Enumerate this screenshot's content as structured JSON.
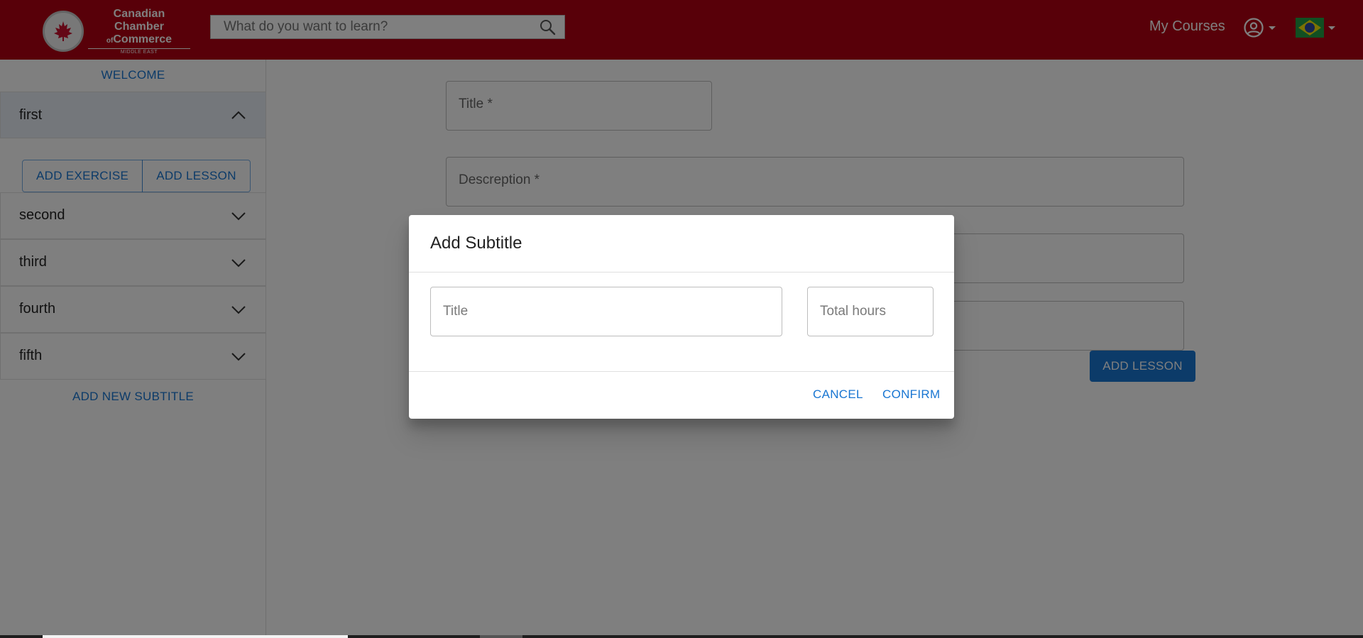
{
  "header": {
    "logo": {
      "seal_text": "CanCham",
      "line1": "Canadian Chamber",
      "line2_prefix": "of",
      "line2": "Commerce",
      "line3": "MIDDLE EAST"
    },
    "search": {
      "placeholder": "What do you want to learn?",
      "icon": "search-icon"
    },
    "my_courses": "My Courses",
    "account_icon": "account-circle-icon",
    "language_flag": "brazil-flag-icon"
  },
  "sidebar": {
    "welcome": "WELCOME",
    "items": [
      {
        "label": "first",
        "expanded": true
      },
      {
        "label": "second",
        "expanded": false
      },
      {
        "label": "third",
        "expanded": false
      },
      {
        "label": "fourth",
        "expanded": false
      },
      {
        "label": "fifth",
        "expanded": false
      }
    ],
    "add_exercise": "ADD EXERCISE",
    "add_lesson": "ADD LESSON",
    "add_new_subtitle": "ADD NEW SUBTITLE"
  },
  "main": {
    "title_placeholder": "Title *",
    "description_placeholder": "Descreption *",
    "add_lesson": "ADD LESSON"
  },
  "dialog": {
    "title": "Add Subtitle",
    "title_placeholder": "Title",
    "hours_placeholder": "Total hours",
    "cancel": "CANCEL",
    "confirm": "CONFIRM"
  },
  "colors": {
    "header": "#b00012",
    "accent": "#1976d2",
    "overlay": "rgba(0,0,0,0.5)"
  }
}
